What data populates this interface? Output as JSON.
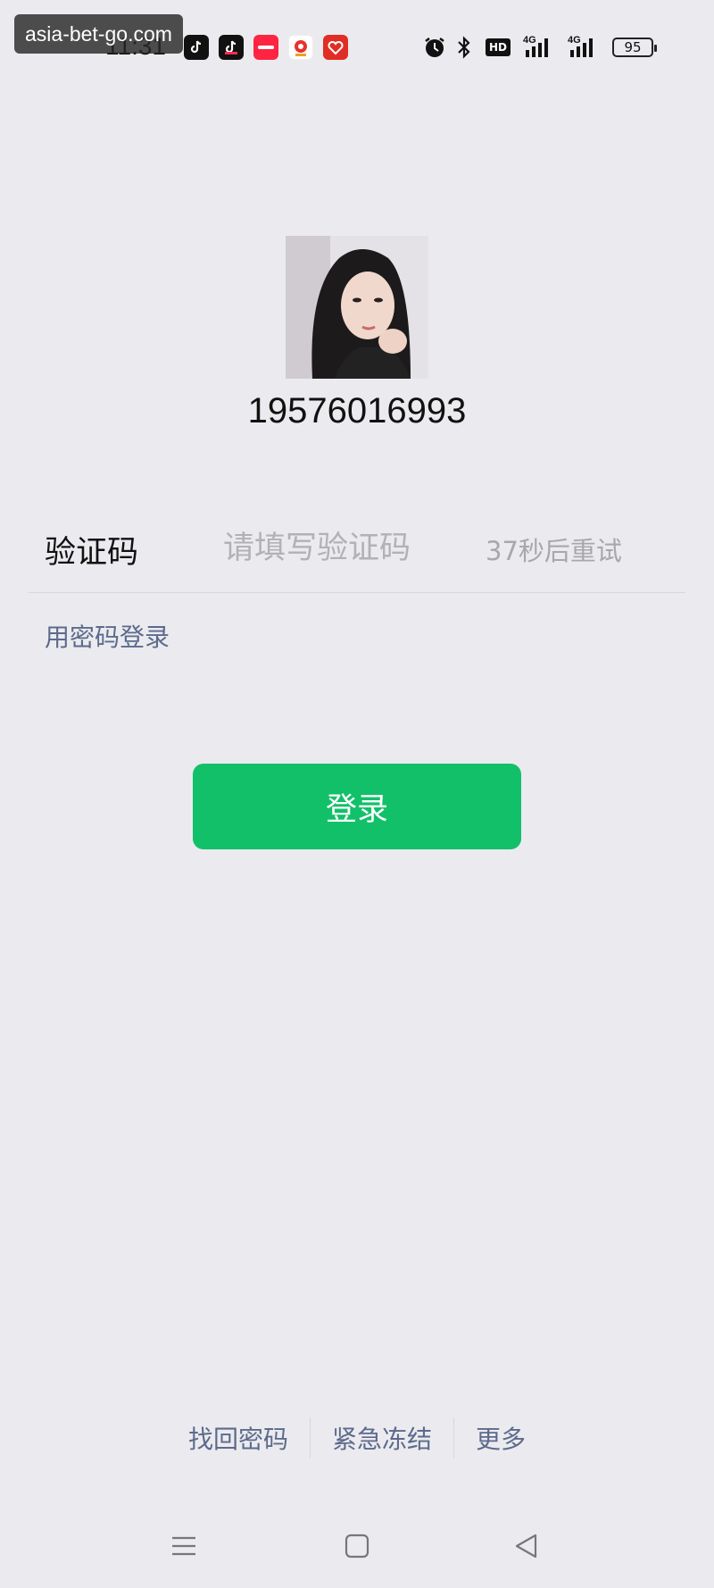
{
  "status_bar": {
    "watermark": "asia-bet-go.com",
    "time": "11:31",
    "battery": "95",
    "network_1": "4G",
    "network_2": "4G",
    "hd_label": "HD"
  },
  "profile": {
    "phone": "19576016993"
  },
  "verification": {
    "label": "验证码",
    "placeholder": "请填写验证码",
    "resend_countdown": "37秒后重试"
  },
  "password_login_link": "用密码登录",
  "login_button": "登录",
  "footer": {
    "links": [
      "找回密码",
      "紧急冻结",
      "更多"
    ]
  },
  "colors": {
    "background": "#ebebef",
    "primary_green": "#12c06a",
    "link_blue": "#5c6a8c",
    "muted_text": "#a7a7ac"
  },
  "icons": {
    "status_apps": [
      "tiktok-icon",
      "tiktok-lite-icon",
      "xiaohongshu-icon",
      "location-app-icon",
      "pinduoduo-icon"
    ],
    "status_system": [
      "alarm-icon",
      "bluetooth-icon",
      "hd-icon",
      "signal-icon",
      "signal-icon",
      "battery-icon"
    ],
    "nav": [
      "menu-icon",
      "home-icon",
      "back-icon"
    ]
  }
}
